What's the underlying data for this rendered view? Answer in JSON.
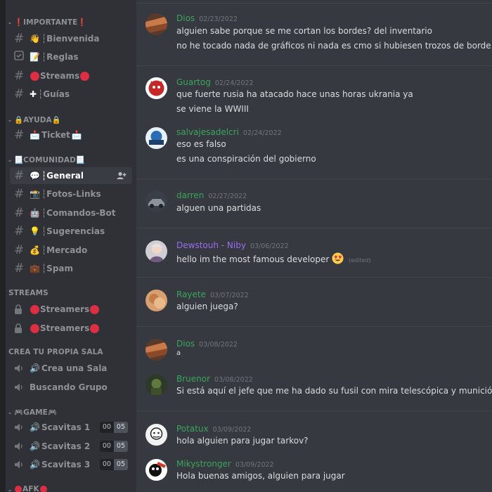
{
  "sidebar": {
    "categories": {
      "importante": "❗IMPORTANTE❗",
      "ayuda": "🔒AYUDA🔒",
      "comunidad": "📃COMUNIDAD📃",
      "streams": "STREAMS",
      "crea": "CREA TU PROPIA SALA",
      "game": "🎮GAME🎮",
      "afk": "AFK"
    },
    "channels": {
      "bienvenida": "┆Bienvenida",
      "reglas": "┆Reglas",
      "streams": "Streams",
      "guias": "┆Guías",
      "ticket": "Ticket",
      "general": "┆General",
      "fotos": "┆Fotos-Links",
      "comandos": "┆Comandos-Bot",
      "sugerencias": "┆Sugerencias",
      "mercado": "┆Mercado",
      "spam": "┆Spam",
      "streamers1": "Streamers",
      "streamers2": "Streamers",
      "creasala": "Crea una Sala",
      "buscando": "Buscando Grupo",
      "scav1": "Scavitas 1",
      "scav2": "Scavitas 2",
      "scav3": "Scavitas 3"
    },
    "scav_counts": [
      {
        "current": "00",
        "limit": "05"
      },
      {
        "current": "00",
        "limit": "05"
      },
      {
        "current": "00",
        "limit": "05"
      }
    ]
  },
  "messages": [
    {
      "author": "Dios",
      "color": "#3ba55d",
      "timestamp": "02/23/2022",
      "lines": [
        "alguien sabe porque se me cortan los bordes? del inventario",
        "no he tocado nada de gráficos ni nada es cmo si hubiesen trozos de borde por ejemplo en el"
      ]
    },
    {
      "author": "Guartog",
      "color": "#3ba55d",
      "timestamp": "02/24/2022",
      "lines": [
        "que fuerte rusia ha atacado hace unas horas ukrania ya",
        "se viene la WWIII"
      ]
    },
    {
      "author": "salvajesadelcri",
      "color": "#3ba55d",
      "timestamp": "02/24/2022",
      "lines": [
        "eso es falso",
        "es una conspiración del gobierno"
      ]
    },
    {
      "author": "darren",
      "color": "#3ba55d",
      "timestamp": "02/27/2022",
      "lines": [
        "alguen una partidas"
      ]
    },
    {
      "author": "Dewstouh - Niby",
      "color": "#9b6cf2",
      "timestamp": "03/06/2022",
      "lines": [
        "hello im the most famous developer"
      ],
      "edited": "(edited)"
    },
    {
      "author": "Rayete",
      "color": "#3ba55d",
      "timestamp": "03/07/2022",
      "lines": [
        "alguien juega?"
      ]
    },
    {
      "author": "Dios",
      "color": "#3ba55d",
      "timestamp": "03/08/2022",
      "lines": [
        "a"
      ]
    },
    {
      "author": "Bruenor",
      "color": "#3ba55d",
      "timestamp": "03/08/2022",
      "lines": [
        "Si está aquí el jefe que me ha dado su fusil con mira telescópica y munición en customs, grac"
      ]
    },
    {
      "author": "Potatux",
      "color": "#3ba55d",
      "timestamp": "03/09/2022",
      "lines": [
        "hola alguien para jugar tarkov?"
      ]
    },
    {
      "author": "Mikystronger",
      "color": "#3ba55d",
      "timestamp": "03/09/2022",
      "lines": [
        "Hola buenas amigos, alguien para jugar"
      ]
    }
  ]
}
